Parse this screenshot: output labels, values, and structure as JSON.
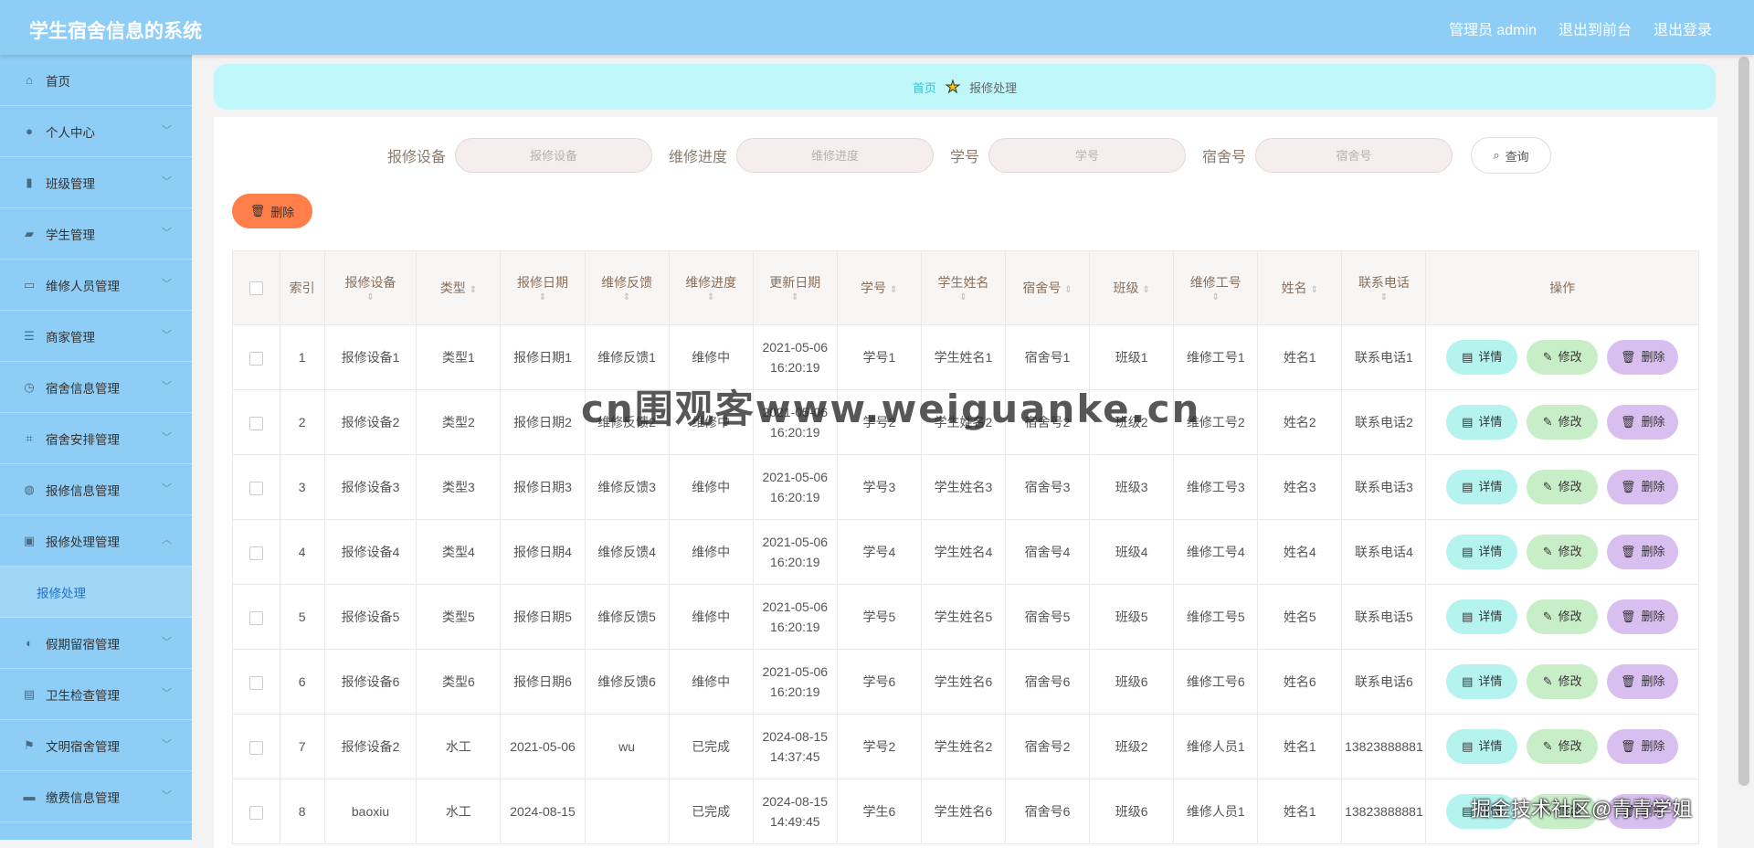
{
  "header": {
    "title": "学生宿舍信息的系统",
    "admin_label": "管理员 admin",
    "front_link": "退出到前台",
    "logout_link": "退出登录"
  },
  "sidebar": {
    "items": [
      {
        "label": "首页",
        "icon": "home-icon"
      },
      {
        "label": "个人中心",
        "icon": "user-icon"
      },
      {
        "label": "班级管理",
        "icon": "bar-chart-icon"
      },
      {
        "label": "学生管理",
        "icon": "student-icon"
      },
      {
        "label": "维修人员管理",
        "icon": "id-card-icon"
      },
      {
        "label": "商家管理",
        "icon": "sliders-icon"
      },
      {
        "label": "宿舍信息管理",
        "icon": "clock-icon"
      },
      {
        "label": "宿舍安排管理",
        "icon": "crop-icon"
      },
      {
        "label": "报修信息管理",
        "icon": "globe-icon"
      },
      {
        "label": "报修处理管理",
        "icon": "briefcase-icon"
      },
      {
        "label": "假期留宿管理",
        "icon": "mic-icon"
      },
      {
        "label": "卫生检查管理",
        "icon": "message-icon"
      },
      {
        "label": "文明宿舍管理",
        "icon": "flag-icon"
      },
      {
        "label": "缴费信息管理",
        "icon": "wallet-icon"
      }
    ],
    "submenu_label": "报修处理"
  },
  "breadcrumb": {
    "home": "首页",
    "current": "报修处理"
  },
  "search": {
    "fields": [
      {
        "label": "报修设备",
        "placeholder": "报修设备"
      },
      {
        "label": "维修进度",
        "placeholder": "维修进度"
      },
      {
        "label": "学号",
        "placeholder": "学号"
      },
      {
        "label": "宿舍号",
        "placeholder": "宿舍号"
      }
    ],
    "query_label": "查询"
  },
  "toolbar": {
    "delete_label": "删除"
  },
  "table": {
    "headers": [
      "索引",
      "报修设备",
      "类型",
      "报修日期",
      "维修反馈",
      "维修进度",
      "更新日期",
      "学号",
      "学生姓名",
      "宿舍号",
      "班级",
      "维修工号",
      "姓名",
      "联系电话",
      "操作"
    ],
    "rows": [
      [
        "1",
        "报修设备1",
        "类型1",
        "报修日期1",
        "维修反馈1",
        "维修中",
        "2021-05-06 16:20:19",
        "学号1",
        "学生姓名1",
        "宿舍号1",
        "班级1",
        "维修工号1",
        "姓名1",
        "联系电话1"
      ],
      [
        "2",
        "报修设备2",
        "类型2",
        "报修日期2",
        "维修反馈2",
        "维修中",
        "2021-05-06 16:20:19",
        "学号2",
        "学生姓名2",
        "宿舍号2",
        "班级2",
        "维修工号2",
        "姓名2",
        "联系电话2"
      ],
      [
        "3",
        "报修设备3",
        "类型3",
        "报修日期3",
        "维修反馈3",
        "维修中",
        "2021-05-06 16:20:19",
        "学号3",
        "学生姓名3",
        "宿舍号3",
        "班级3",
        "维修工号3",
        "姓名3",
        "联系电话3"
      ],
      [
        "4",
        "报修设备4",
        "类型4",
        "报修日期4",
        "维修反馈4",
        "维修中",
        "2021-05-06 16:20:19",
        "学号4",
        "学生姓名4",
        "宿舍号4",
        "班级4",
        "维修工号4",
        "姓名4",
        "联系电话4"
      ],
      [
        "5",
        "报修设备5",
        "类型5",
        "报修日期5",
        "维修反馈5",
        "维修中",
        "2021-05-06 16:20:19",
        "学号5",
        "学生姓名5",
        "宿舍号5",
        "班级5",
        "维修工号5",
        "姓名5",
        "联系电话5"
      ],
      [
        "6",
        "报修设备6",
        "类型6",
        "报修日期6",
        "维修反馈6",
        "维修中",
        "2021-05-06 16:20:19",
        "学号6",
        "学生姓名6",
        "宿舍号6",
        "班级6",
        "维修工号6",
        "姓名6",
        "联系电话6"
      ],
      [
        "7",
        "报修设备2",
        "水工",
        "2021-05-06",
        "wu",
        "已完成",
        "2024-08-15 14:37:45",
        "学号2",
        "学生姓名2",
        "宿舍号2",
        "班级2",
        "维修人员1",
        "姓名1",
        "13823888881"
      ],
      [
        "8",
        "baoxiu",
        "水工",
        "2024-08-15",
        "",
        "已完成",
        "2024-08-15 14:49:45",
        "学生6",
        "学生姓名6",
        "宿舍号6",
        "班级6",
        "维修人员1",
        "姓名1",
        "13823888881"
      ]
    ],
    "actions": {
      "detail": "详情",
      "edit": "修改",
      "delete": "删除"
    }
  },
  "watermarks": {
    "center": "cn围观客www.weiguanke.cn",
    "corner": "掘金技术社区@青青学姐"
  },
  "colors": {
    "header_bg": "#8dcdf6",
    "breadcrumb_bg": "#bff7fa",
    "delete_btn": "#ff7e4a",
    "detail_btn": "#b5f3ef",
    "edit_btn": "#c8eec8",
    "row_delete_btn": "#d9bff0"
  }
}
